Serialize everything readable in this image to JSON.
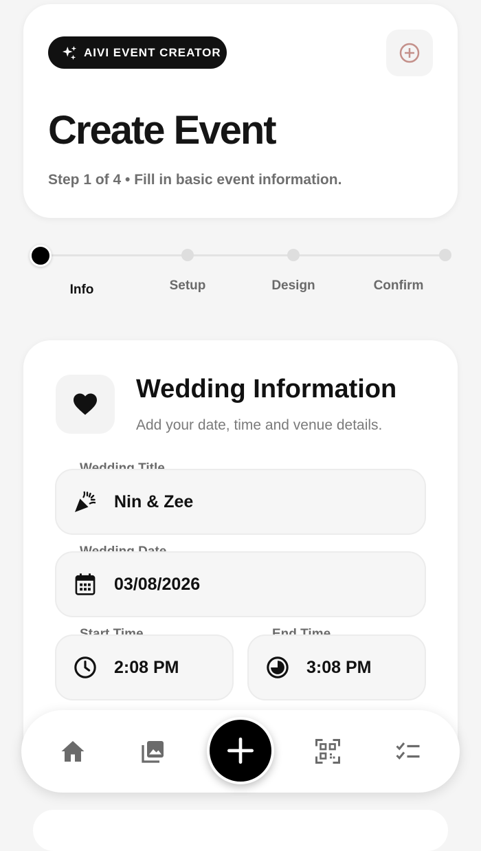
{
  "header": {
    "badge_label": "AIVI EVENT CREATOR",
    "title": "Create Event",
    "subtitle": "Step 1 of 4 • Fill in basic event information."
  },
  "stepper": {
    "current_step": 1,
    "total_steps": 4,
    "steps": [
      "Info",
      "Setup",
      "Design",
      "Confirm"
    ]
  },
  "section": {
    "title": "Wedding Information",
    "subtitle": "Add your date, time and venue details."
  },
  "fields": {
    "wedding_title": {
      "label": "Wedding Title",
      "value": "Nin & Zee",
      "icon": "party-popper-icon"
    },
    "wedding_date": {
      "label": "Wedding Date",
      "value": "03/08/2026",
      "icon": "calendar-icon"
    },
    "start_time": {
      "label": "Start Time",
      "value": "2:08 PM",
      "icon": "clock-icon"
    },
    "end_time": {
      "label": "End Time",
      "value": "3:08 PM",
      "icon": "clock-end-icon"
    }
  },
  "nav": {
    "items": [
      "home-icon",
      "gallery-icon",
      "add-icon",
      "qr-code-icon",
      "checklist-icon"
    ]
  },
  "colors": {
    "accent": "#000000",
    "add_button_icon": "#c4908a",
    "background": "#f5f5f5"
  }
}
